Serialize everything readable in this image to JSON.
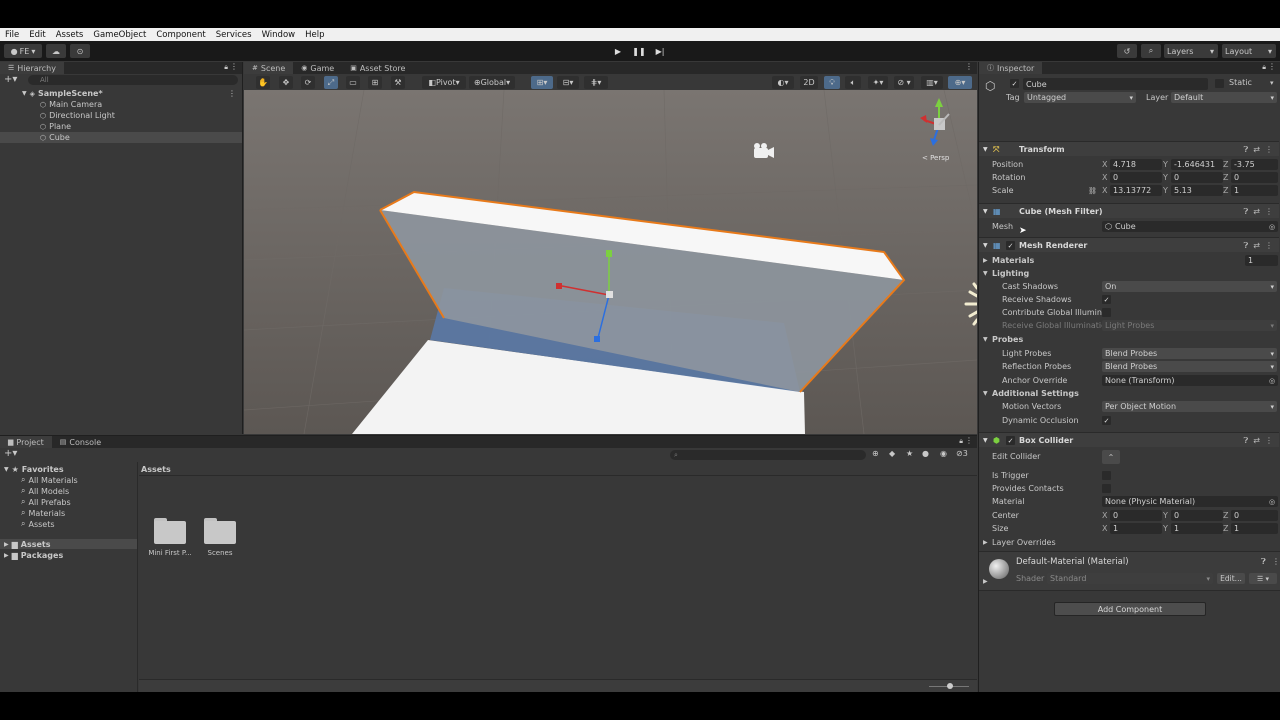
{
  "menu": [
    "File",
    "Edit",
    "Assets",
    "GameObject",
    "Component",
    "Services",
    "Window",
    "Help"
  ],
  "toolbar": {
    "account": "FE",
    "layers": "Layers",
    "layout": "Layout"
  },
  "hierarchy": {
    "tab": "Hierarchy",
    "search_placeholder": "All",
    "scene": "SampleScene*",
    "items": [
      "Main Camera",
      "Directional Light",
      "Plane",
      "Cube"
    ]
  },
  "scene_tabs": [
    "Scene",
    "Game",
    "Asset Store"
  ],
  "scene_toolbar": {
    "pivot": "Pivot",
    "global": "Global",
    "mode_2d": "2D",
    "persp": "< Persp"
  },
  "project": {
    "tabs": [
      "Project",
      "Console"
    ],
    "favorites_label": "Favorites",
    "favorites": [
      "All Materials",
      "All Models",
      "All Prefabs",
      "Materials",
      "Assets"
    ],
    "roots": [
      "Assets",
      "Packages"
    ],
    "breadcrumb": "Assets",
    "hidden_count": "3",
    "folders": [
      "Mini First P...",
      "Scenes"
    ]
  },
  "inspector": {
    "tab": "Inspector",
    "object_name": "Cube",
    "static_label": "Static",
    "tag_label": "Tag",
    "tag_value": "Untagged",
    "layer_label": "Layer",
    "layer_value": "Default",
    "transform": {
      "title": "Transform",
      "position_label": "Position",
      "rotation_label": "Rotation",
      "scale_label": "Scale",
      "position": {
        "x": "4.718",
        "y": "-1.646431",
        "z": "-3.75"
      },
      "rotation": {
        "x": "0",
        "y": "0",
        "z": "0"
      },
      "scale": {
        "x": "13.13772",
        "y": "5.13",
        "z": "1"
      }
    },
    "mesh_filter": {
      "title": "Cube (Mesh Filter)",
      "mesh_label": "Mesh",
      "mesh_value": "Cube"
    },
    "mesh_renderer": {
      "title": "Mesh Renderer",
      "materials_label": "Materials",
      "materials_count": "1",
      "lighting_label": "Lighting",
      "cast_shadows_label": "Cast Shadows",
      "cast_shadows_value": "On",
      "receive_shadows_label": "Receive Shadows",
      "contribute_gi_label": "Contribute Global Illuminat",
      "receive_gi_label": "Receive Global Illuminatio",
      "receive_gi_value": "Light Probes",
      "probes_label": "Probes",
      "light_probes_label": "Light Probes",
      "light_probes_value": "Blend Probes",
      "reflection_probes_label": "Reflection Probes",
      "reflection_probes_value": "Blend Probes",
      "anchor_override_label": "Anchor Override",
      "anchor_override_value": "None (Transform)",
      "additional_label": "Additional Settings",
      "motion_vectors_label": "Motion Vectors",
      "motion_vectors_value": "Per Object Motion",
      "dynamic_occlusion_label": "Dynamic Occlusion"
    },
    "box_collider": {
      "title": "Box Collider",
      "edit_collider_label": "Edit Collider",
      "is_trigger_label": "Is Trigger",
      "provides_contacts_label": "Provides Contacts",
      "material_label": "Material",
      "material_value": "None (Physic Material)",
      "center_label": "Center",
      "size_label": "Size",
      "center": {
        "x": "0",
        "y": "0",
        "z": "0"
      },
      "size": {
        "x": "1",
        "y": "1",
        "z": "1"
      },
      "layer_overrides_label": "Layer Overrides"
    },
    "material": {
      "name": "Default-Material (Material)",
      "shader_label": "Shader",
      "shader_value": "Standard",
      "edit_label": "Edit..."
    },
    "add_component": "Add Component"
  },
  "colors": {
    "selection_outline": "#e87a1a",
    "axis_x": "#d03030",
    "axis_y": "#7cd040",
    "axis_z": "#2b6fe0"
  }
}
